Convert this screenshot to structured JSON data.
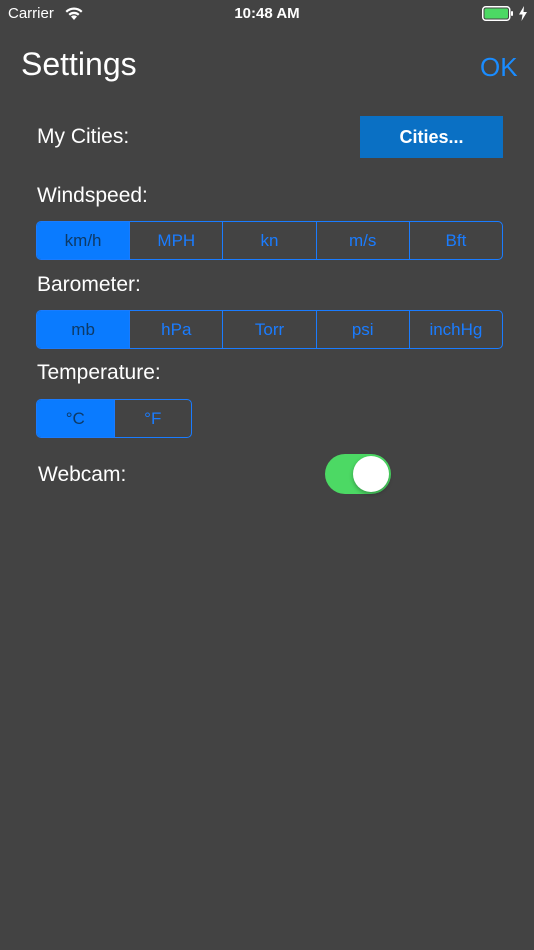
{
  "status_bar": {
    "carrier": "Carrier",
    "time": "10:48 AM"
  },
  "header": {
    "title": "Settings",
    "ok_label": "OK"
  },
  "cities": {
    "label": "My Cities:",
    "button_label": "Cities..."
  },
  "windspeed": {
    "label": "Windspeed:",
    "options": [
      "km/h",
      "MPH",
      "kn",
      "m/s",
      "Bft"
    ],
    "selected": "km/h"
  },
  "barometer": {
    "label": "Barometer:",
    "options": [
      "mb",
      "hPa",
      "Torr",
      "psi",
      "inchHg"
    ],
    "selected": "mb"
  },
  "temperature": {
    "label": "Temperature:",
    "options": [
      "°C",
      "°F"
    ],
    "selected": "°C"
  },
  "webcam": {
    "label": "Webcam:",
    "enabled": true
  },
  "colors": {
    "background": "#434343",
    "accent": "#1a7cff",
    "button_blue": "#0a70c4",
    "toggle_on": "#4cd964",
    "battery": "#4cd964"
  }
}
